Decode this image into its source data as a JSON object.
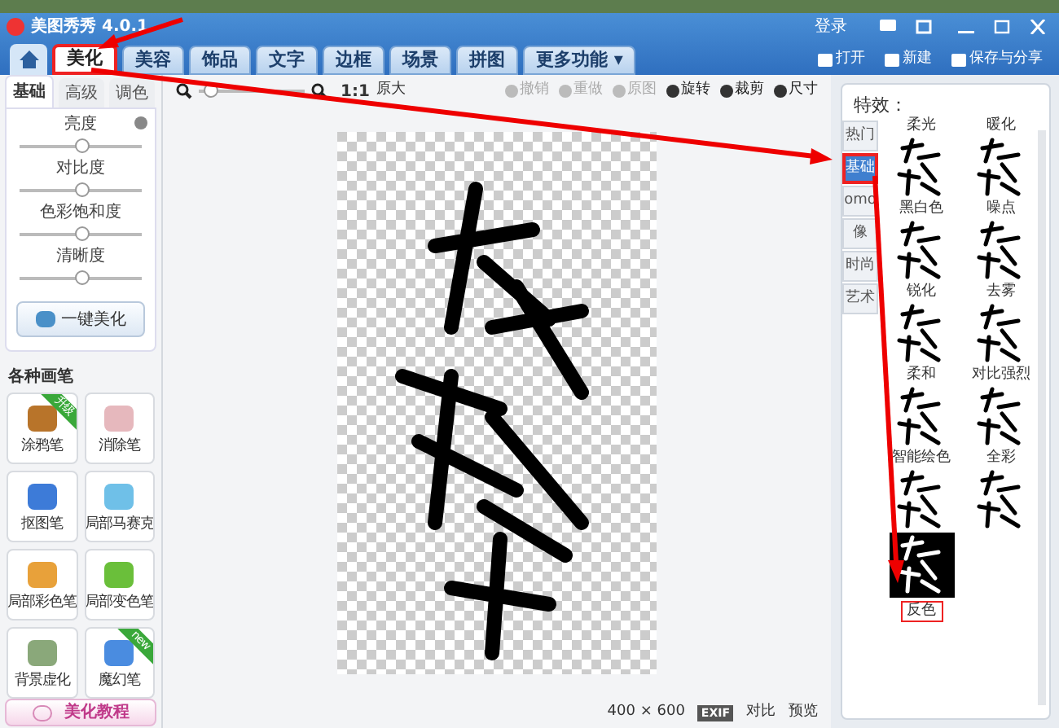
{
  "window": {
    "title": "美图秀秀 4.0.1",
    "login": "登录"
  },
  "main_tabs": [
    {
      "label": "美化",
      "selected": true,
      "highlighted": true
    },
    {
      "label": "美容",
      "selected": false,
      "highlighted": false
    },
    {
      "label": "饰品",
      "selected": false,
      "highlighted": false
    },
    {
      "label": "文字",
      "selected": false,
      "highlighted": false
    },
    {
      "label": "边框",
      "selected": false,
      "highlighted": false
    },
    {
      "label": "场景",
      "selected": false,
      "highlighted": false
    },
    {
      "label": "拼图",
      "selected": false,
      "highlighted": false
    },
    {
      "label": "更多功能 ▾",
      "selected": false,
      "highlighted": false
    }
  ],
  "file_actions": [
    "打开",
    "新建",
    "保存与分享"
  ],
  "left_panel": {
    "tabs": [
      {
        "label": "基础",
        "selected": true
      },
      {
        "label": "高级",
        "selected": false
      },
      {
        "label": "调色",
        "selected": false
      }
    ],
    "sliders": [
      {
        "label": "亮度",
        "level": 0.5
      },
      {
        "label": "对比度",
        "level": 0.5
      },
      {
        "label": "色彩饱和度",
        "level": 0.5
      },
      {
        "label": "清晰度",
        "level": 0.5
      }
    ],
    "auto_button": "一键美化",
    "brushes_title": "各种画笔",
    "brushes": [
      {
        "label": "涂鸦笔",
        "badge": "升级"
      },
      {
        "label": "消除笔"
      },
      {
        "label": "抠图笔"
      },
      {
        "label": "局部马赛克"
      },
      {
        "label": "局部彩色笔"
      },
      {
        "label": "局部变色笔"
      },
      {
        "label": "背景虚化"
      },
      {
        "label": "魔幻笔",
        "badge": "new"
      }
    ],
    "tutorial_button": "美化教程"
  },
  "toolbar": {
    "zoom": {
      "level": 0.05
    },
    "actual_size": "1:1",
    "actual_size_label": "原大",
    "actions": [
      {
        "label": "撤销",
        "disabled": true
      },
      {
        "label": "重做",
        "disabled": true
      },
      {
        "label": "原图",
        "disabled": true
      },
      {
        "label": "旋转",
        "disabled": false
      },
      {
        "label": "裁剪",
        "disabled": false
      },
      {
        "label": "尺寸",
        "disabled": false
      }
    ]
  },
  "status_bar": {
    "size": "400 × 600",
    "exif": "EXIF",
    "compare": "对比",
    "preview": "预览"
  },
  "effects_panel": {
    "title": "特效：",
    "categories": [
      {
        "label": "热门",
        "selected": false,
        "highlighted": false
      },
      {
        "label": "基础",
        "selected": true,
        "highlighted": true
      },
      {
        "label": "omo",
        "selected": false,
        "highlighted": false
      },
      {
        "label": "像",
        "selected": false,
        "highlighted": false
      },
      {
        "label": "时尚",
        "selected": false,
        "highlighted": false
      },
      {
        "label": "艺术",
        "selected": false,
        "highlighted": false
      }
    ],
    "effects": [
      {
        "label": "柔光",
        "selected": false
      },
      {
        "label": "暖化",
        "selected": false
      },
      {
        "label": "黑白色",
        "selected": false
      },
      {
        "label": "噪点",
        "selected": false
      },
      {
        "label": "锐化",
        "selected": false
      },
      {
        "label": "去雾",
        "selected": false
      },
      {
        "label": "柔和",
        "selected": false
      },
      {
        "label": "对比强烈",
        "selected": false
      },
      {
        "label": "智能绘色",
        "selected": false
      },
      {
        "label": "全彩",
        "selected": false
      },
      {
        "label": "反色",
        "selected": true
      }
    ]
  }
}
